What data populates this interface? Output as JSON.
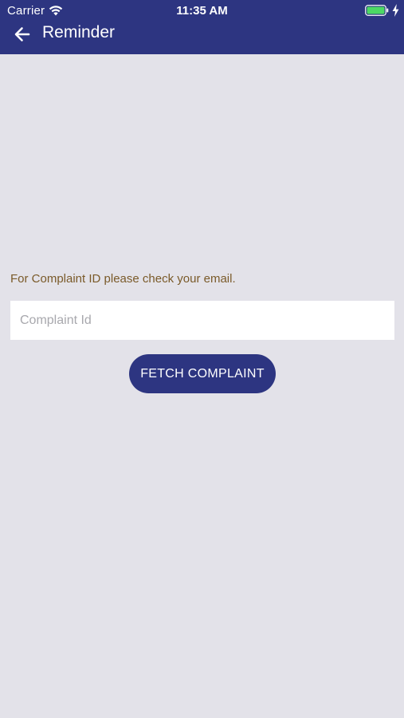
{
  "status_bar": {
    "carrier": "Carrier",
    "time": "11:35 AM",
    "wifi_icon": "wifi-icon",
    "battery_icon": "battery-full-icon",
    "charging_icon": "charging-bolt-icon"
  },
  "nav": {
    "back_icon": "arrow-left-icon",
    "title": "Reminder"
  },
  "main": {
    "instruction": "For Complaint ID please check your email.",
    "complaint_input": {
      "value": "",
      "placeholder": "Complaint Id"
    },
    "fetch_button_label": "FETCH COMPLAINT"
  },
  "colors": {
    "header_background": "#2d3581",
    "page_background": "#e3e2e9",
    "instruction_text": "#7a5a29",
    "button_background": "#2d3581",
    "battery_fill": "#4cd964"
  }
}
